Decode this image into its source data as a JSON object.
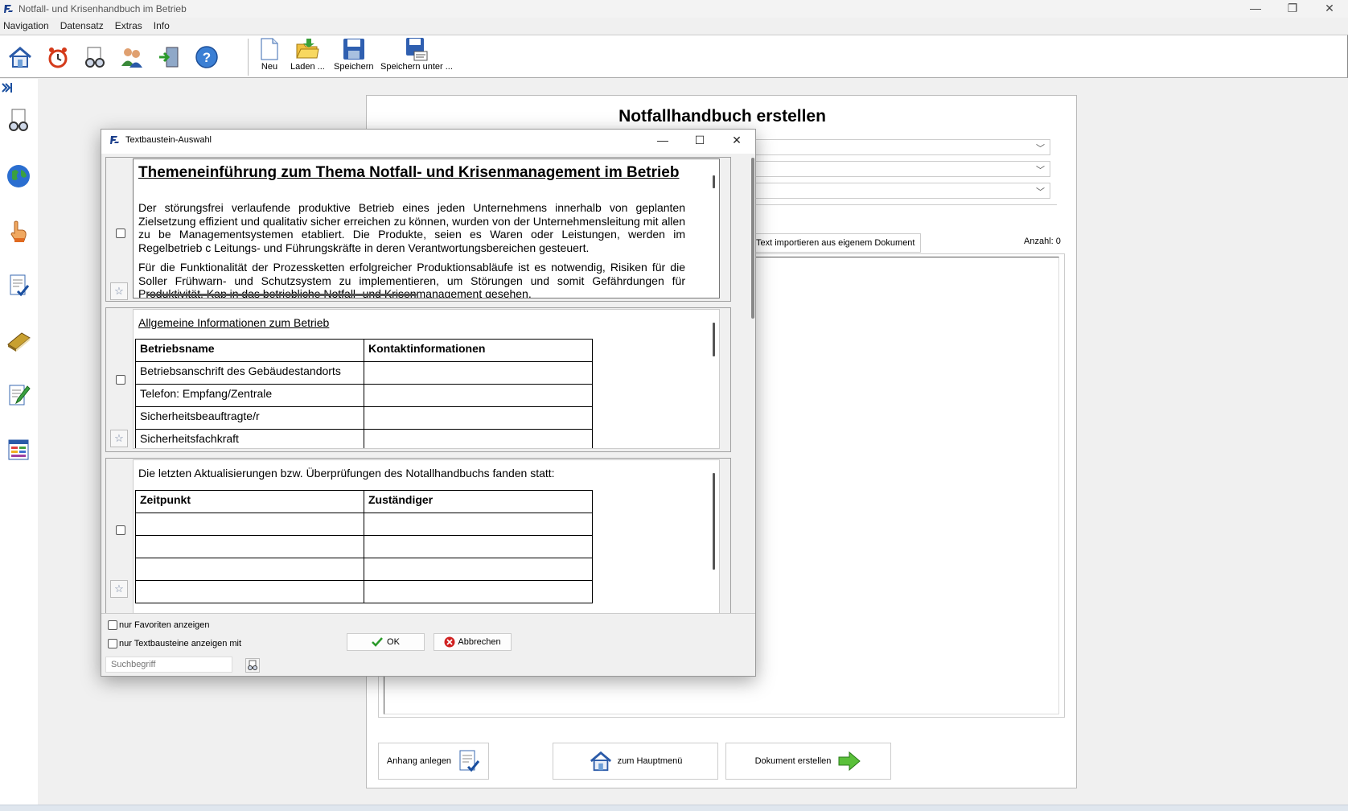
{
  "window": {
    "title": "Notfall- und Krisenhandbuch im Betrieb",
    "controls": [
      "—",
      "❐",
      "✕"
    ]
  },
  "menu": [
    "Navigation",
    "Datensatz",
    "Extras",
    "Info"
  ],
  "toolbar": {
    "buttons": [
      {
        "label": "Neu",
        "icon": "new-document-icon"
      },
      {
        "label": "Laden ...",
        "icon": "open-folder-icon"
      },
      {
        "label": "Speichern",
        "icon": "save-disk-icon"
      },
      {
        "label": "Speichern unter ...",
        "icon": "save-as-disk-icon"
      }
    ],
    "nav_icons": [
      "home-icon",
      "alarm-clock-icon",
      "search-glasses-icon",
      "users-icon",
      "exit-door-icon",
      "help-icon"
    ]
  },
  "sidebar": {
    "expand_icon": "expand-sidebar-icon",
    "icons": [
      "document-search-icon",
      "globe-icon",
      "hand-pointer-icon",
      "checklist-icon",
      "book-icon",
      "edit-document-icon",
      "table-icon"
    ]
  },
  "panel": {
    "title": "Notfallhandbuch erstellen",
    "import_button": "Text importieren aus eigenem Dokument",
    "count_label": "Anzahl: 0",
    "buttons": {
      "attach": "Anhang anlegen",
      "main_menu": "zum Hauptmenü",
      "create": "Dokument erstellen"
    }
  },
  "dialog": {
    "title": "Textbaustein-Auswahl",
    "controls": [
      "—",
      "☐",
      "✕"
    ],
    "block1": {
      "heading": "Themeneinführung zum Thema Notfall- und Krisenmanagement im Betrieb",
      "paragraph1": "Der störungsfrei verlaufende produktive Betrieb eines jeden Unternehmens innerhalb von geplanten Zielsetzung effizient und qualitativ sicher erreichen zu können, wurden von der Unternehmensleitung mit allen zu be Managementsystemen etabliert. Die Produkte, seien es Waren oder Leistungen, werden im Regelbetrieb c Leitungs- und Führungskräfte in deren Verantwortungsbereichen gesteuert.",
      "paragraph2": "Für die Funktionalität der Prozessketten erfolgreicher Produktionsabläufe ist es notwendig, Risiken für die Soller Frühwarn- und Schutzsystem zu implementieren, um Störungen und somit Gefährdungen für Produktivität, Kap in das betriebliche Notfall- und Krisenmanagement gesehen."
    },
    "block2": {
      "heading": "Allgemeine Informationen zum Betrieb",
      "headers": [
        "Betriebsname",
        "Kontaktinformationen"
      ],
      "rows": [
        "Betriebsanschrift des Gebäudestandorts",
        "Telefon: Empfang/Zentrale",
        "Sicherheitsbeauftragte/r",
        "Sicherheitsfachkraft"
      ]
    },
    "block3": {
      "heading": "Die letzten Aktualisierungen bzw. Überprüfungen des Notallhandbuchs fanden statt:",
      "headers": [
        "Zeitpunkt",
        "Zuständiger"
      ]
    },
    "footer": {
      "fav_label": "nur Favoriten anzeigen",
      "text_label": "nur Textbausteine anzeigen mit",
      "search_placeholder": "Suchbegriff",
      "ok": "OK",
      "cancel": "Abbrechen"
    }
  }
}
